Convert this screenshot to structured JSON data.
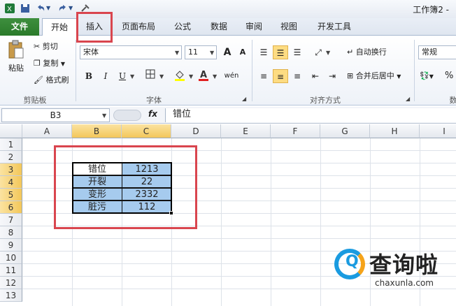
{
  "window": {
    "title": "工作簿2 -"
  },
  "quick_access": {
    "save_icon": "save-icon",
    "undo_icon": "undo-icon",
    "redo_icon": "redo-icon"
  },
  "tabs": [
    {
      "label": "文件"
    },
    {
      "label": "开始"
    },
    {
      "label": "插入"
    },
    {
      "label": "页面布局"
    },
    {
      "label": "公式"
    },
    {
      "label": "数据"
    },
    {
      "label": "审阅"
    },
    {
      "label": "视图"
    },
    {
      "label": "开发工具"
    }
  ],
  "clipboard": {
    "paste": "粘贴",
    "cut": "剪切",
    "copy": "复制",
    "format_painter": "格式刷",
    "group_label": "剪贴板"
  },
  "font": {
    "name": "宋体",
    "size": "11",
    "grow": "A",
    "shrink": "A",
    "bold": "B",
    "italic": "I",
    "underline": "U",
    "phonetic": "wén",
    "group_label": "字体"
  },
  "alignment": {
    "wrap_text": "自动换行",
    "merge_center": "合并后居中",
    "group_label": "对齐方式"
  },
  "number": {
    "format": "常规",
    "percent": "%",
    "group_label": "数"
  },
  "formula_bar": {
    "name_box": "B3",
    "fx": "fx",
    "content": "错位"
  },
  "columns": [
    "A",
    "B",
    "C",
    "D",
    "E",
    "F",
    "G",
    "H",
    "I"
  ],
  "rows": [
    "1",
    "2",
    "3",
    "4",
    "5",
    "6",
    "7",
    "8",
    "9",
    "10",
    "11",
    "12",
    "13"
  ],
  "table": [
    {
      "label": "错位",
      "value": "1213"
    },
    {
      "label": "开裂",
      "value": "22"
    },
    {
      "label": "变形",
      "value": "2332"
    },
    {
      "label": "脏污",
      "value": "112"
    }
  ],
  "colors": {
    "highlight": "#d9454e",
    "selection_fill": "#a6cbee",
    "file_tab": "#2a7a2a"
  },
  "watermark": {
    "name": "查询啦",
    "url": "chaxunla.com"
  }
}
